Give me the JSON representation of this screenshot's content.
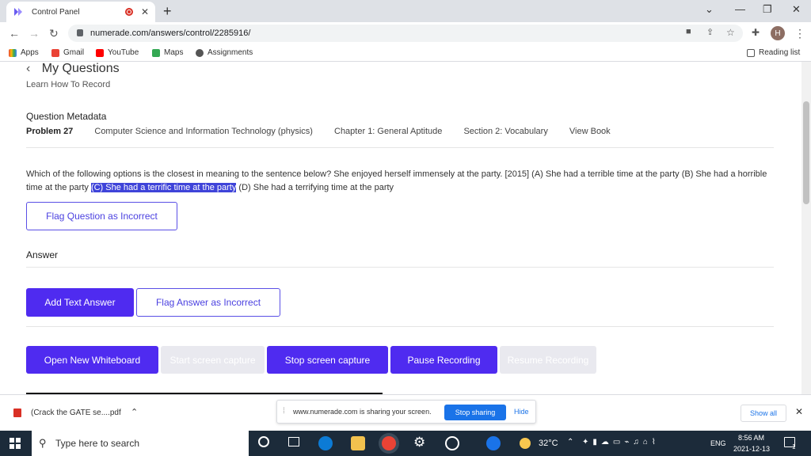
{
  "browser": {
    "tab_title": "Control Panel",
    "tab_close": "✕",
    "new_tab": "+",
    "url": "numerade.com/answers/control/2285916/",
    "window_controls": [
      "⌄",
      "—",
      "❐",
      "✕"
    ]
  },
  "bookmarks": [
    "Apps",
    "Gmail",
    "YouTube",
    "Maps",
    "Assignments"
  ],
  "reading_list": "Reading list",
  "profile_initial": "H",
  "page": {
    "title": "My Questions",
    "subtitle": "Learn How To Record",
    "metadata_heading": "Question Metadata",
    "problem": "Problem 27",
    "subject": "Computer Science and Information Technology (physics)",
    "chapter": "Chapter 1: General Aptitude",
    "section": "Section 2: Vocabulary",
    "view_book": "View Book",
    "question_before": "Which of the following options is the closest in meaning to the sentence below? She enjoyed herself immensely at the party. [2015] (A) She had a terrible time at the party (B) She had a horrible time at the party ",
    "question_highlight": "(C) She had a terrific time at the party",
    "question_after": " (D) She had a terrifying time at the party",
    "flag_question": "Flag Question as Incorrect",
    "answer_heading": "Answer",
    "add_text_answer": "Add Text Answer",
    "flag_answer": "Flag Answer as Incorrect",
    "buttons": {
      "open_whiteboard": "Open New Whiteboard",
      "start_capture": "Start screen capture",
      "stop_capture": "Stop screen capture",
      "pause_recording": "Pause Recording",
      "resume_recording": "Resume Recording"
    }
  },
  "downloads": {
    "file": "(Crack the GATE se....pdf",
    "share_text": "www.numerade.com is sharing your screen.",
    "stop_sharing": "Stop sharing",
    "hide": "Hide",
    "show_all": "Show all"
  },
  "taskbar": {
    "search_placeholder": "Type here to search",
    "temperature": "32°C",
    "language": "ENG",
    "time": "8:56 AM",
    "date": "2021-12-13",
    "notifications": "1"
  },
  "colors": {
    "primary": "#4f2bf0",
    "highlight": "#3f44d9",
    "taskbar": "#1c2b3a"
  }
}
